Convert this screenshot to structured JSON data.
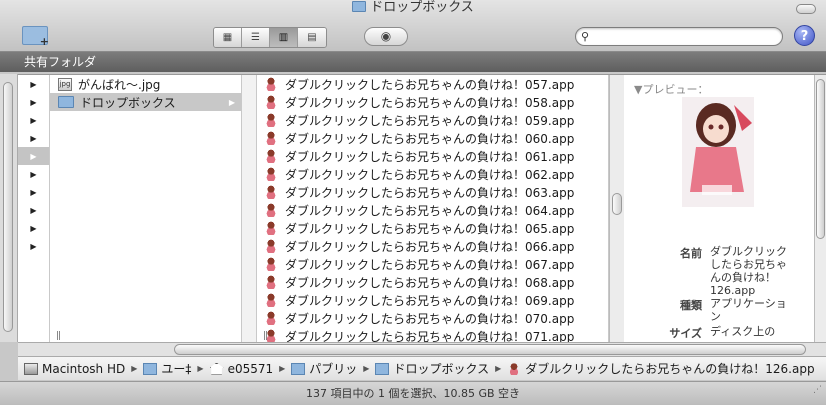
{
  "window": {
    "title": "ドロップボックス",
    "title_icon": "folder-icon"
  },
  "toolbar": {
    "new_folder_icon": "new-folder-icon",
    "view_buttons": [
      {
        "name": "icon-view",
        "glyph": "▦"
      },
      {
        "name": "list-view",
        "glyph": "☰"
      },
      {
        "name": "column-view",
        "glyph": "▥",
        "selected": true
      },
      {
        "name": "coverflow-view",
        "glyph": "▤"
      }
    ],
    "quicklook_glyph": "◉",
    "search_value": "",
    "search_glyph": "🔍",
    "help_glyph": "?"
  },
  "sidebar_header": "共有フォルダ",
  "column1": {
    "arrows": [
      "▶",
      "▶",
      "▶",
      "▶",
      "▶",
      "▶",
      "▶",
      "▶",
      "▶",
      "▶"
    ]
  },
  "column2": {
    "items": [
      {
        "label": "がんばれ〜.jpg",
        "icon": "image-file-icon"
      },
      {
        "label": "ドロップボックス",
        "icon": "folder-icon",
        "selected": true,
        "arrow": "▶"
      }
    ],
    "grip": "||"
  },
  "column3": {
    "items": [
      "ダブルクリックしたらお兄ちゃんの負けね！057.app",
      "ダブルクリックしたらお兄ちゃんの負けね！058.app",
      "ダブルクリックしたらお兄ちゃんの負けね！059.app",
      "ダブルクリックしたらお兄ちゃんの負けね！060.app",
      "ダブルクリックしたらお兄ちゃんの負けね！061.app",
      "ダブルクリックしたらお兄ちゃんの負けね！062.app",
      "ダブルクリックしたらお兄ちゃんの負けね！063.app",
      "ダブルクリックしたらお兄ちゃんの負けね！064.app",
      "ダブルクリックしたらお兄ちゃんの負けね！065.app",
      "ダブルクリックしたらお兄ちゃんの負けね！066.app",
      "ダブルクリックしたらお兄ちゃんの負けね！067.app",
      "ダブルクリックしたらお兄ちゃんの負けね！068.app",
      "ダブルクリックしたらお兄ちゃんの負けね！069.app",
      "ダブルクリックしたらお兄ちゃんの負けね！070.app",
      "ダブルクリックしたらお兄ちゃんの負けね！071.app"
    ],
    "grip": "||"
  },
  "preview": {
    "header": "▼プレビュー：",
    "name_label": "名前",
    "name_value": "ダブルクリックしたらお兄ちゃんの負けね！126.app",
    "kind_label": "種類",
    "kind_value": "アプリケーション",
    "size_label": "サイズ",
    "size_value": "ディスク上の"
  },
  "path": [
    {
      "label": "Macintosh HD",
      "icon": "hard-drive-icon"
    },
    {
      "label": "ユー‡",
      "icon": "users-folder-icon"
    },
    {
      "label": "e05571",
      "icon": "home-icon"
    },
    {
      "label": "パブリッ",
      "icon": "public-folder-icon"
    },
    {
      "label": "ドロップボックス",
      "icon": "folder-icon"
    },
    {
      "label": "ダブルクリックしたらお兄ちゃんの負けね！126.app",
      "icon": "app-icon"
    }
  ],
  "path_separator": "▶",
  "status": "137 項目中の 1 個を選択、10.85 GB 空き",
  "colors": {
    "selection": "#c8c8c8",
    "shared_bar": "#6e6e6e",
    "folder": "#8fb6de"
  }
}
